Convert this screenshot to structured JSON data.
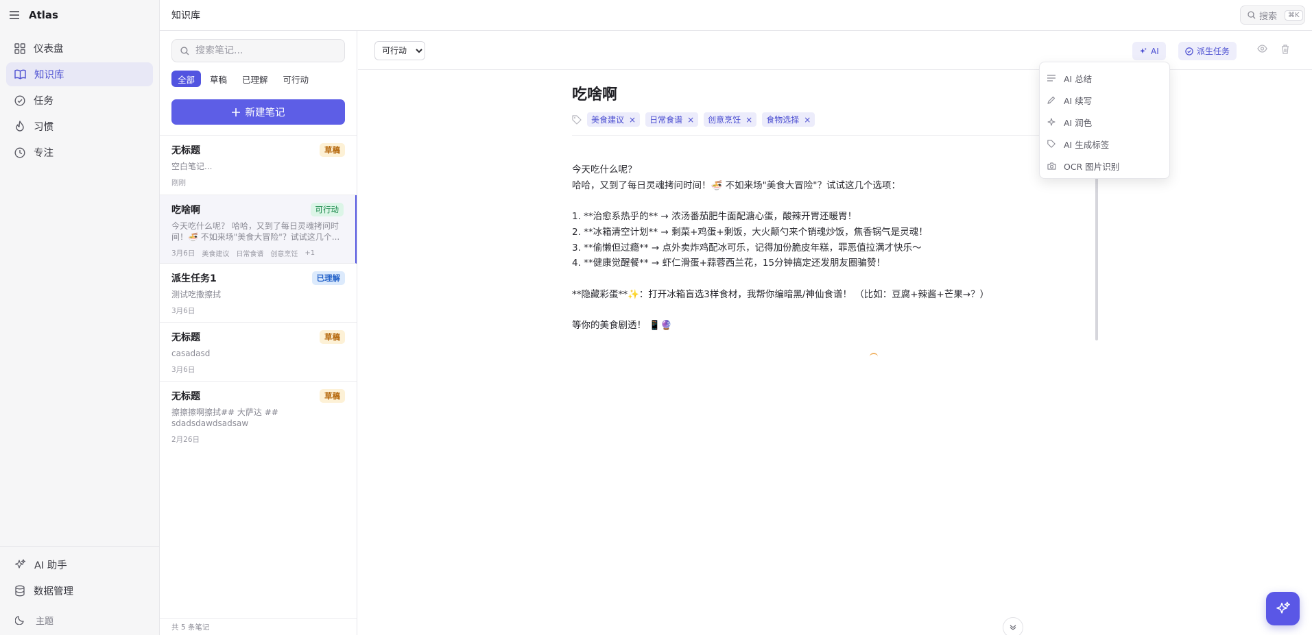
{
  "app": {
    "name": "Atlas"
  },
  "sidebar": {
    "items": [
      {
        "label": "仪表盘",
        "icon": "dashboard-icon"
      },
      {
        "label": "知识库",
        "icon": "book-icon"
      },
      {
        "label": "任务",
        "icon": "check-circle-icon"
      },
      {
        "label": "习惯",
        "icon": "flame-icon"
      },
      {
        "label": "专注",
        "icon": "clock-icon"
      }
    ],
    "bottom": [
      {
        "label": "AI 助手",
        "icon": "sparkles-icon"
      },
      {
        "label": "数据管理",
        "icon": "database-icon"
      }
    ],
    "theme_label": "主题"
  },
  "topbar": {
    "breadcrumb": "知识库",
    "search_label": "搜索",
    "search_kbd": "⌘K"
  },
  "notes_panel": {
    "search_placeholder": "搜索笔记...",
    "filters": [
      "全部",
      "草稿",
      "已理解",
      "可行动"
    ],
    "new_note_label": "新建笔记",
    "notes": [
      {
        "title": "无标题",
        "badge": "草稿",
        "excerpt": "空白笔记...",
        "date": "刚刚"
      },
      {
        "title": "吃啥啊",
        "badge": "可行动",
        "excerpt": "今天吃什么呢？ 哈哈，又到了每日灵魂拷问时间！🍜 不如来场\"美食大冒险\"？试试这几个...",
        "date": "3月6日",
        "tags": [
          "美食建议",
          "日常食谱",
          "创意烹饪"
        ],
        "more": "+1"
      },
      {
        "title": "派生任务1",
        "badge": "已理解",
        "excerpt": "测试吃撒擦拭",
        "date": "3月6日"
      },
      {
        "title": "无标题",
        "badge": "草稿",
        "excerpt": "casadasd",
        "date": "3月6日"
      },
      {
        "title": "无标题",
        "badge": "草稿",
        "excerpt": "擦擦擦啊擦拭## 大萨达 ## sdadsdawdsadsaw",
        "date": "2月26日"
      }
    ],
    "count_label": "共 5 条笔记"
  },
  "editor": {
    "status_value": "可行动",
    "status_options": [
      "可行动"
    ],
    "ai_button": "AI",
    "derive_button": "派生任务",
    "title": "吃啥啊",
    "tags": [
      "美食建议",
      "日常食谱",
      "创意烹饪",
      "食物选择"
    ],
    "body": "今天吃什么呢？\n哈哈，又到了每日灵魂拷问时间！🍜 不如来场\"美食大冒险\"？试试这几个选项：\n\n1. **治愈系热乎的** → 浓汤番茄肥牛面配溏心蛋，酸辣开胃还暖胃！\n2. **冰箱清空计划** → 剩菜+鸡蛋+剩饭，大火颠勺来个销魂炒饭，焦香锅气是灵魂！\n3. **偷懒但过瘾** → 点外卖炸鸡配冰可乐，记得加份脆皮年糕，罪恶值拉满才快乐～\n4. **健康觉醒餐** → 虾仁滑蛋+蒜蓉西兰花，15分钟搞定还发朋友圈骗赞！\n\n**隐藏彩蛋**✨：打开冰箱盲选3样食材，我帮你编暗黑/神仙食谱！ （比如：豆腐+辣酱+芒果→？）\n\n等你的美食剧透！ 📱🔮"
  },
  "ai_menu": {
    "items": [
      {
        "label": "AI 总结",
        "icon": "lines-icon"
      },
      {
        "label": "AI 续写",
        "icon": "pencil-icon"
      },
      {
        "label": "AI 润色",
        "icon": "sparkle-icon"
      },
      {
        "label": "AI 生成标签",
        "icon": "tag-icon"
      },
      {
        "label": "OCR 图片识别",
        "icon": "camera-icon"
      }
    ]
  },
  "colors": {
    "accent": "#5254e0",
    "draft": "#b5680d",
    "action": "#1d8a4d",
    "understood": "#2563c9"
  }
}
